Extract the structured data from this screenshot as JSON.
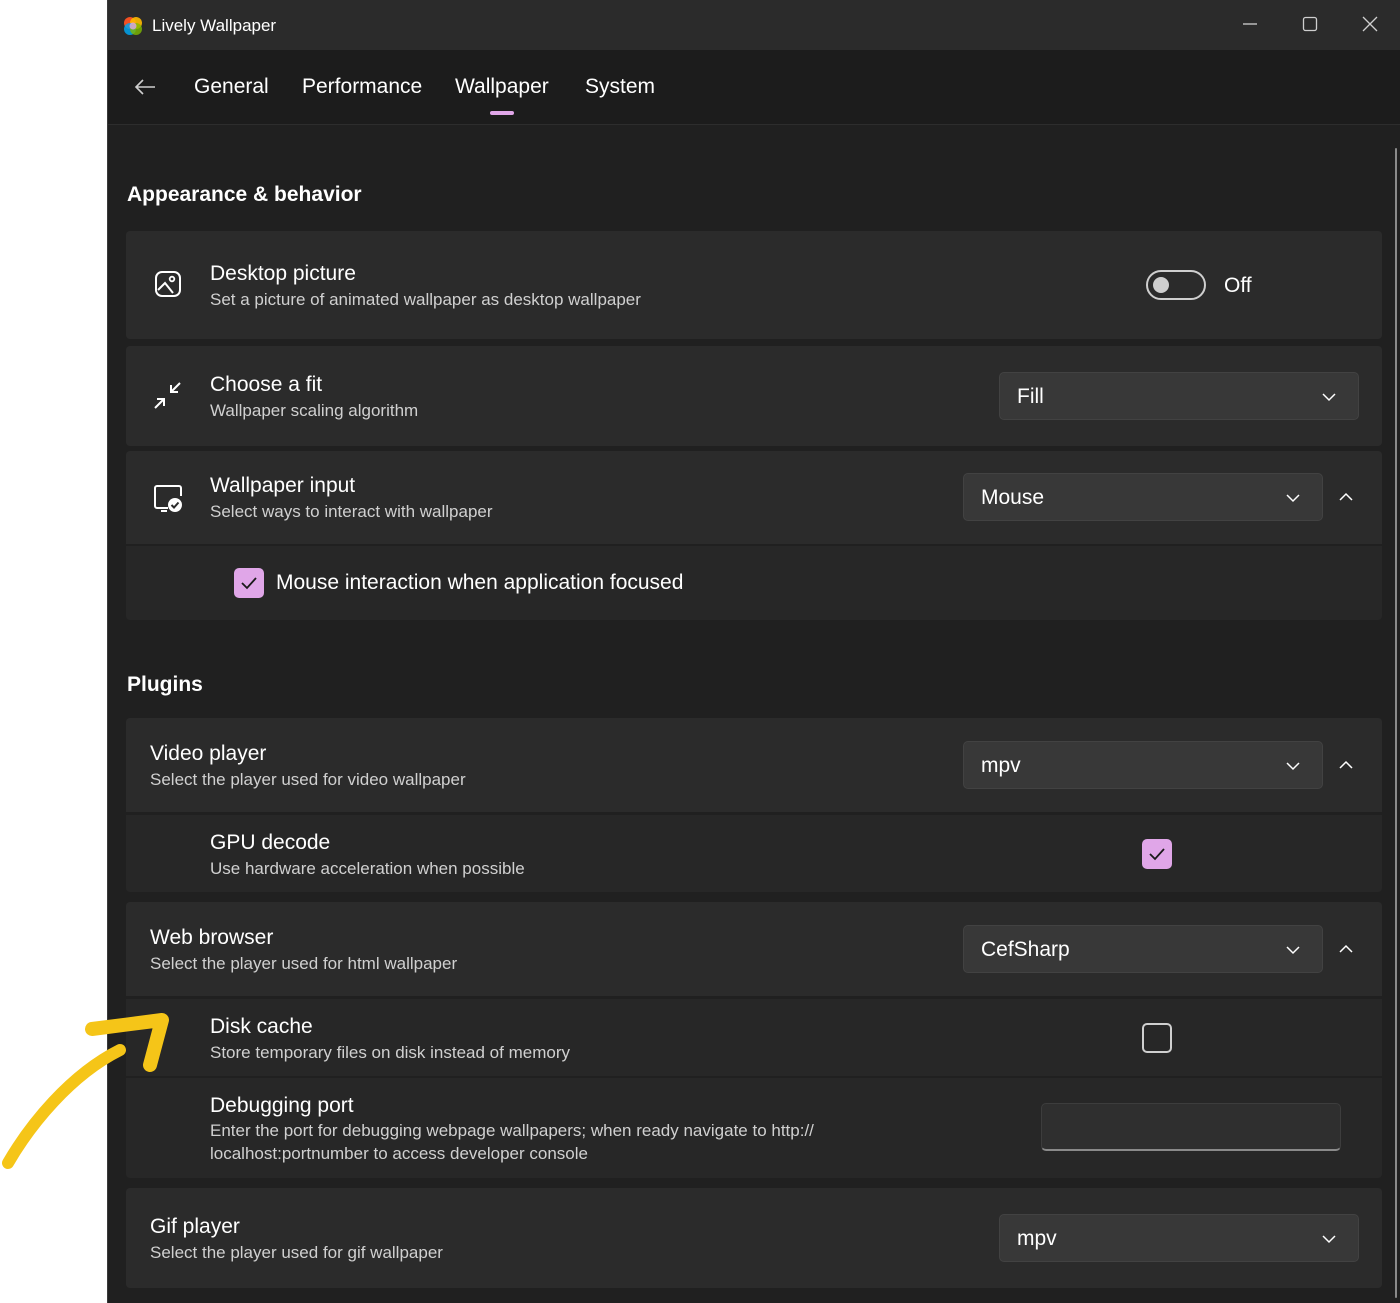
{
  "window": {
    "title": "Lively Wallpaper"
  },
  "colors": {
    "accent": "#e0a6e8",
    "annotation": "#f5c518",
    "background": "#202020",
    "card": "#2b2b2b"
  },
  "nav": {
    "back_icon": "arrow-left-icon",
    "tabs": [
      {
        "label": "General",
        "selected": false
      },
      {
        "label": "Performance",
        "selected": false
      },
      {
        "label": "Wallpaper",
        "selected": true
      },
      {
        "label": "System",
        "selected": false
      }
    ]
  },
  "appearance": {
    "heading": "Appearance & behavior",
    "desktop_picture": {
      "title": "Desktop picture",
      "desc": "Set a picture of animated wallpaper as desktop wallpaper",
      "toggle_state": "Off",
      "icon": "image-icon"
    },
    "choose_fit": {
      "title": "Choose a fit",
      "desc": "Wallpaper scaling algorithm",
      "value": "Fill",
      "icon": "shrink-icon"
    },
    "wallpaper_input": {
      "title": "Wallpaper input",
      "desc": "Select ways to interact with wallpaper",
      "value": "Mouse",
      "icon": "monitor-check-icon",
      "mouse_focus": {
        "label": "Mouse interaction when application focused",
        "checked": true
      }
    }
  },
  "plugins": {
    "heading": "Plugins",
    "video_player": {
      "title": "Video player",
      "desc": "Select the player used for video wallpaper",
      "value": "mpv",
      "gpu_decode": {
        "title": "GPU decode",
        "desc": "Use hardware acceleration when possible",
        "checked": true
      }
    },
    "web_browser": {
      "title": "Web browser",
      "desc": "Select the player used for html wallpaper",
      "value": "CefSharp",
      "disk_cache": {
        "title": "Disk cache",
        "desc": "Store temporary files on disk instead of memory",
        "checked": false
      },
      "debug_port": {
        "title": "Debugging port",
        "desc_line1": "Enter the port for debugging webpage wallpapers; when ready navigate to http://",
        "desc_line2": "localhost:portnumber to access developer console",
        "value": ""
      }
    },
    "gif_player": {
      "title": "Gif player",
      "desc": "Select the player used for gif wallpaper",
      "value": "mpv"
    }
  }
}
